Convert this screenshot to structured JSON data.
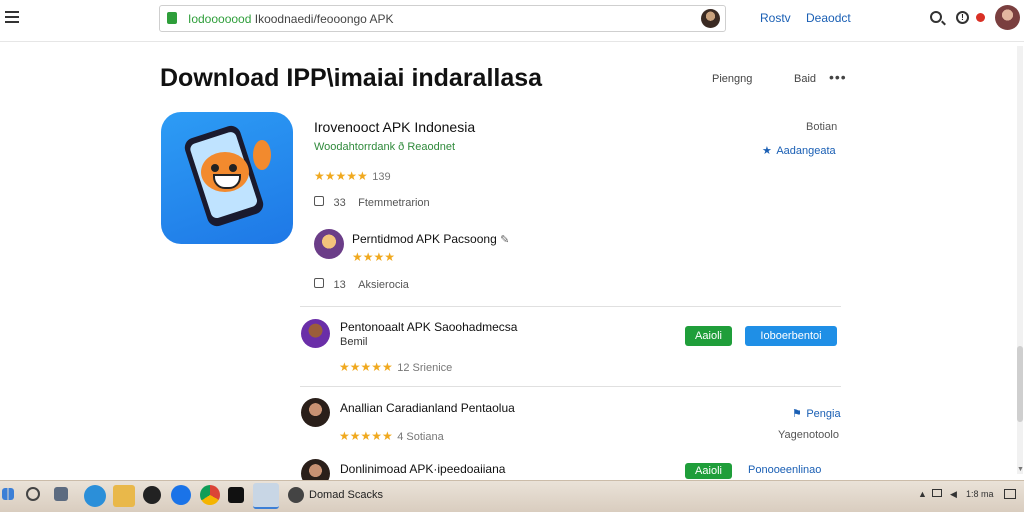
{
  "browser": {
    "address": {
      "site": "Iodooooood",
      "rest": "Ikoodnaedi/feooongo APK"
    },
    "links": [
      "Rostv",
      "Deaodct"
    ]
  },
  "page": {
    "title": "Download IPP\\imaiai indarallasa",
    "title_links": [
      "Piengng",
      "Baid"
    ],
    "more": "•••"
  },
  "app": {
    "name": "Irovenooct APK Indonesia",
    "subtitle": "Woodahtorrdank ð Reaodnet",
    "stars": "★★★★★",
    "rating_count": "139",
    "likes": "33",
    "likes_label": "Ftemmetrarion",
    "right_label": "Botian",
    "right_link": "Aadangeata"
  },
  "comment": {
    "title": "Perntidmod APK Pacsoong",
    "stars": "★★★★",
    "likes": "13",
    "likes_label": "Aksierocia"
  },
  "list": [
    {
      "title": "Pentonoaalt APK Saoohadmecsa",
      "subtitle": "Bemil",
      "stars": "★★★★★",
      "meta": "12 Srienice",
      "button_green": "Aaioli",
      "button_blue": "Ioboerbentoi"
    },
    {
      "title": "Anallian Caradianland Pentaolua",
      "stars": "★★★★★",
      "meta": "4 Sotiana",
      "right_link": "Pengia",
      "right_text": "Yagenotoolo"
    },
    {
      "title": "Donlinimoad APK·ipeedoaiiana",
      "button_green": "Aaioli",
      "right_link": "Ponooeenlinao"
    }
  ],
  "taskbar": {
    "active_label": "Domad Scacks",
    "tray_time": "1:8 ma"
  },
  "colors": {
    "accent_blue": "#1f8fe6",
    "accent_green": "#1f9e3a",
    "star": "#f0a91f"
  }
}
